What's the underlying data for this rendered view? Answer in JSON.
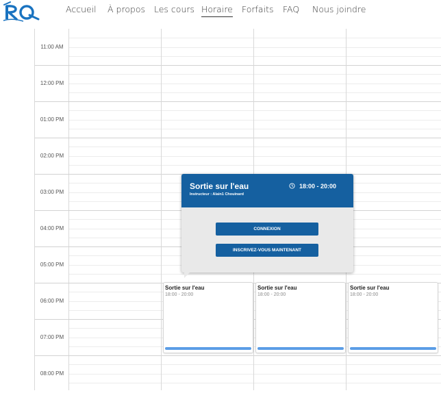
{
  "header": {
    "logo_alt": "RQ",
    "nav": [
      {
        "label": "Accueil"
      },
      {
        "label": "À propos"
      },
      {
        "label": "Les cours"
      },
      {
        "label": "Horaire",
        "active": true
      },
      {
        "label": "Forfaits"
      },
      {
        "label": "FAQ"
      },
      {
        "label": "Nous joindre"
      }
    ]
  },
  "schedule": {
    "times": [
      "11:00 AM",
      "12:00 PM",
      "01:00 PM",
      "02:00 PM",
      "03:00 PM",
      "04:00 PM",
      "05:00 PM",
      "06:00 PM",
      "07:00 PM",
      "08:00 PM"
    ],
    "events": [
      {
        "title": "Sortie sur l'eau",
        "time": "18:00 - 20:00"
      },
      {
        "title": "Sortie sur l'eau",
        "time": "18:00 - 20:00"
      },
      {
        "title": "Sortie sur l'eau",
        "time": "18:00 - 20:00"
      }
    ]
  },
  "popup": {
    "title": "Sortie sur l'eau",
    "instructor": "Instructeur : Alain1 Chouinard",
    "time": "18:00 - 20:00",
    "login_label": "CONNEXION",
    "signup_label": "INSCRIVEZ-VOUS MAINTENANT"
  },
  "colors": {
    "primary": "#1560a0",
    "event_bar": "#5b9de6",
    "logo_blue": "#1a73c0"
  }
}
